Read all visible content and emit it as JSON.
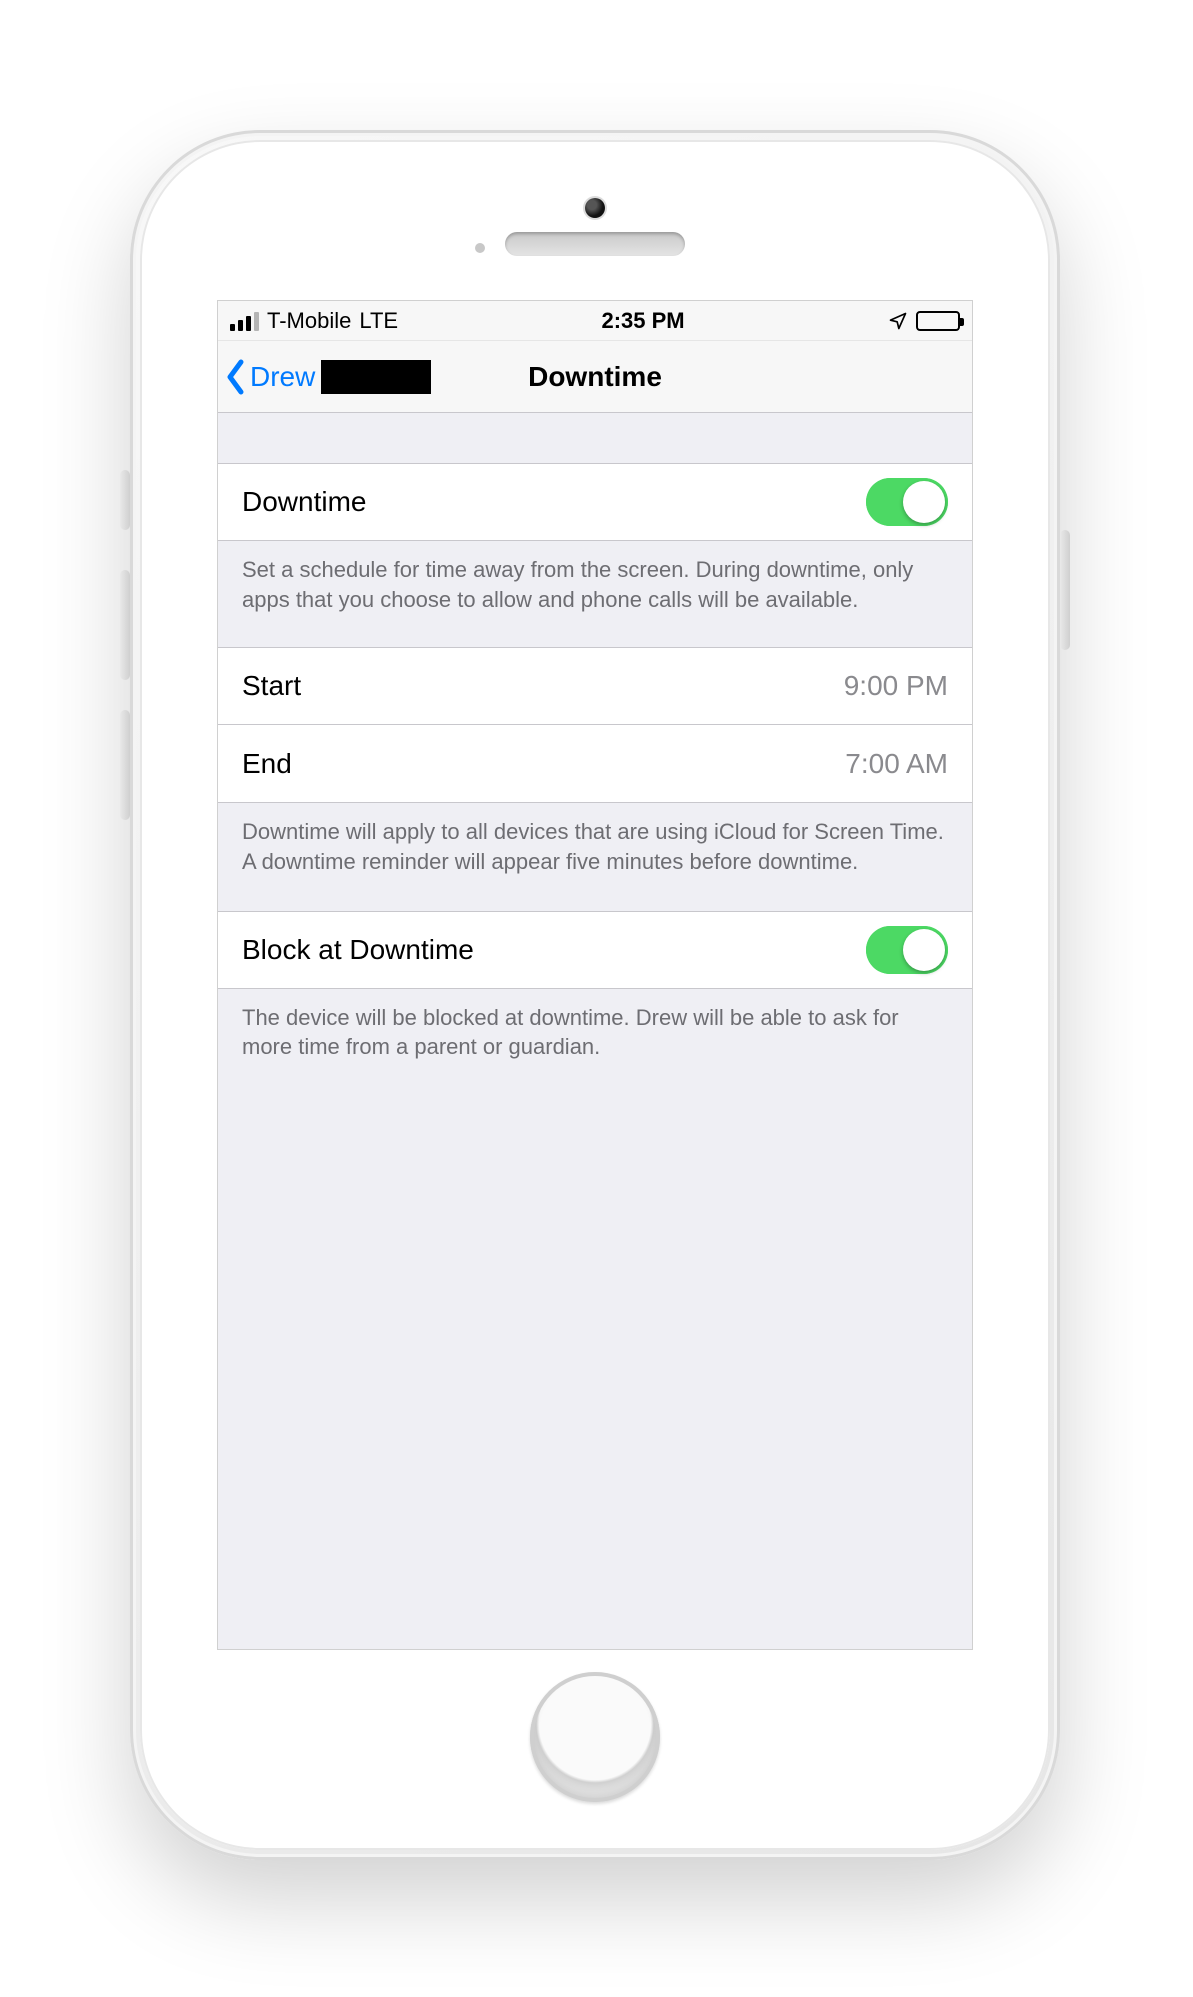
{
  "statusbar": {
    "carrier": "T-Mobile",
    "network": "LTE",
    "time": "2:35 PM"
  },
  "nav": {
    "back_label": "Drew",
    "title": "Downtime"
  },
  "rows": {
    "downtime_label": "Downtime",
    "downtime_on": true,
    "downtime_desc": "Set a schedule for time away from the screen. During downtime, only apps that you choose to allow and phone calls will be available.",
    "start_label": "Start",
    "start_value": "9:00 PM",
    "end_label": "End",
    "end_value": "7:00 AM",
    "schedule_desc": "Downtime will apply to all devices that are using iCloud for Screen Time. A downtime reminder will appear five minutes before downtime.",
    "block_label": "Block at Downtime",
    "block_on": true,
    "block_desc": "The device will be blocked at downtime. Drew will be able to ask for more time from a parent or guardian."
  },
  "colors": {
    "accent": "#007aff",
    "toggle_on": "#4cd964",
    "bg": "#efeff4",
    "secondary_text": "#6d6d72"
  }
}
